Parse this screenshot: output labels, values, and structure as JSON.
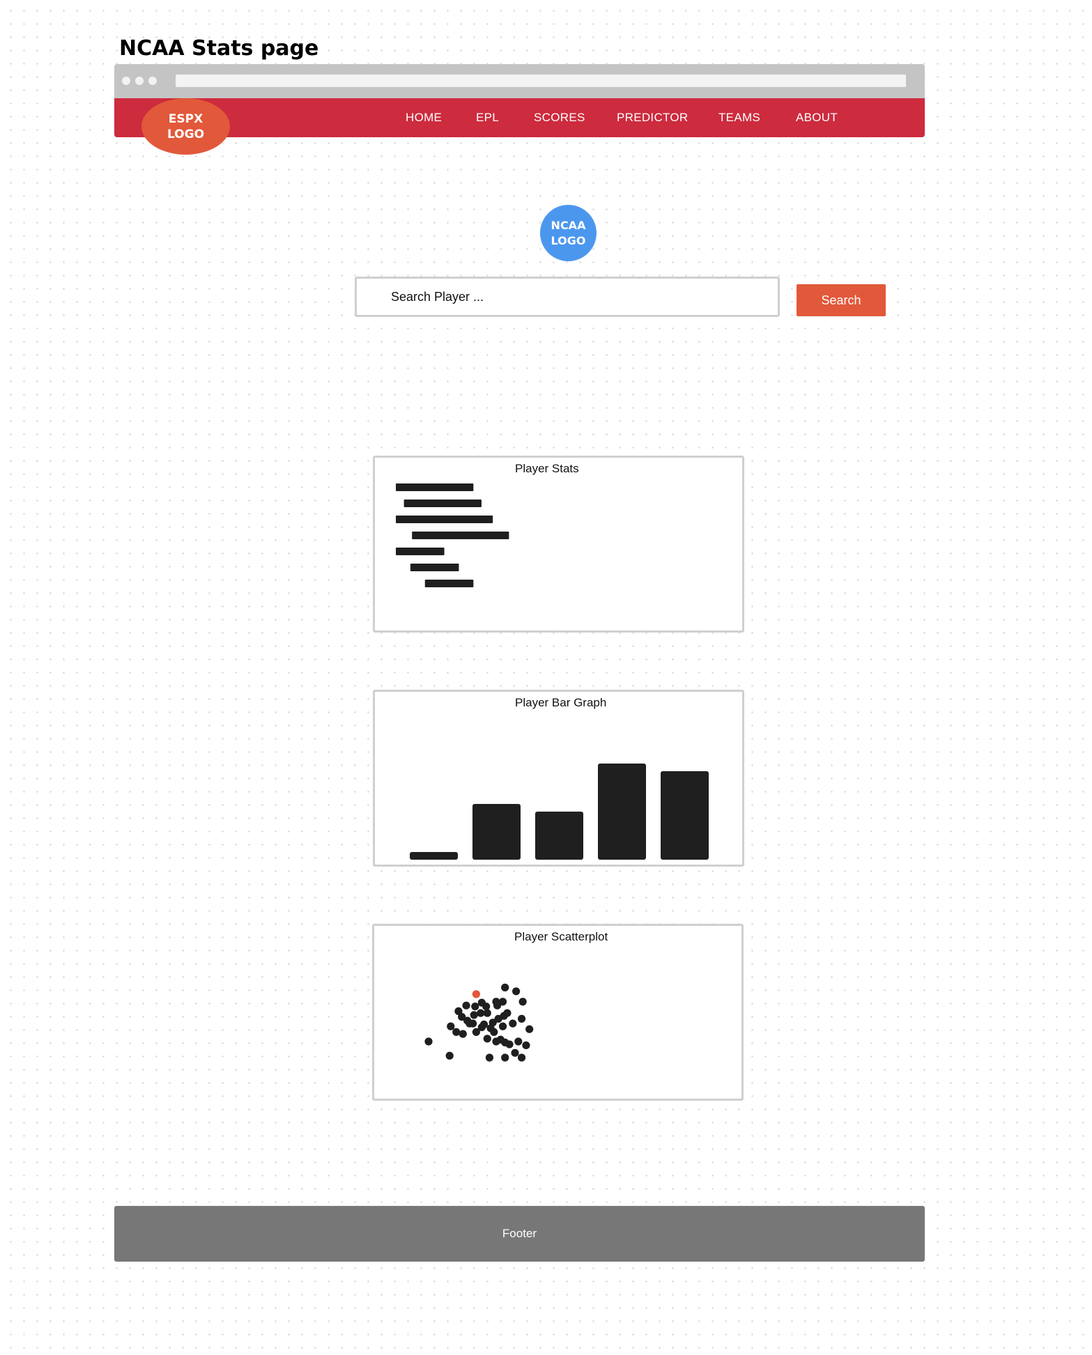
{
  "page": {
    "title": "NCAA Stats page"
  },
  "header": {
    "logo_text": "ESPX\nLOGO",
    "nav": [
      {
        "label": "HOME"
      },
      {
        "label": "EPL"
      },
      {
        "label": "SCORES"
      },
      {
        "label": "PREDICTOR"
      },
      {
        "label": "TEAMS"
      },
      {
        "label": "ABOUT"
      }
    ]
  },
  "main": {
    "ncaa_logo_text": "NCAA\nLOGO",
    "search": {
      "placeholder": "Search Player ...",
      "button_label": "Search"
    },
    "panels": {
      "stats": {
        "title": "Player Stats"
      },
      "bar": {
        "title": "Player Bar Graph"
      },
      "scatter": {
        "title": "Player Scatterplot"
      }
    }
  },
  "footer": {
    "label": "Footer"
  },
  "colors": {
    "nav_red": "#cd2b3e",
    "accent_orange": "#e2583a",
    "ncaa_blue": "#4b97ee",
    "footer_gray": "#777777",
    "ink": "#1f1f1f"
  },
  "chart_data": [
    {
      "type": "bar",
      "orientation": "horizontal",
      "note": "placeholder skeleton lines",
      "values": [
        {
          "offset": 0,
          "length": 48
        },
        {
          "offset": 5,
          "length": 48
        },
        {
          "offset": 0,
          "length": 60
        },
        {
          "offset": 10,
          "length": 60
        },
        {
          "offset": 0,
          "length": 30
        },
        {
          "offset": 9,
          "length": 30
        },
        {
          "offset": 18,
          "length": 30
        }
      ]
    },
    {
      "type": "bar",
      "values": [
        0.08,
        0.58,
        0.5,
        1.0,
        0.92
      ]
    },
    {
      "type": "scatter",
      "points": [
        {
          "x": 0.0,
          "y": 0.0
        },
        {
          "x": 0.19,
          "y": -0.15
        },
        {
          "x": 0.25,
          "y": 0.1
        },
        {
          "x": 0.2,
          "y": 0.16
        },
        {
          "x": 0.3,
          "y": 0.26
        },
        {
          "x": 0.35,
          "y": 0.22
        },
        {
          "x": 0.42,
          "y": 0.37
        },
        {
          "x": 0.43,
          "y": 0.5,
          "highlight": true
        },
        {
          "x": 0.37,
          "y": 0.19
        },
        {
          "x": 0.27,
          "y": 0.32
        },
        {
          "x": 0.31,
          "y": 0.08
        },
        {
          "x": 0.4,
          "y": 0.19
        },
        {
          "x": 0.47,
          "y": 0.3
        },
        {
          "x": 0.41,
          "y": 0.28
        },
        {
          "x": 0.43,
          "y": 0.1
        },
        {
          "x": 0.52,
          "y": 0.37
        },
        {
          "x": 0.53,
          "y": 0.3
        },
        {
          "x": 0.58,
          "y": 0.2
        },
        {
          "x": 0.56,
          "y": 0.14
        },
        {
          "x": 0.48,
          "y": 0.15
        },
        {
          "x": 0.53,
          "y": 0.03
        },
        {
          "x": 0.5,
          "y": 0.18
        },
        {
          "x": 0.59,
          "y": 0.1
        },
        {
          "x": 0.63,
          "y": 0.24
        },
        {
          "x": 0.62,
          "y": 0.38
        },
        {
          "x": 0.67,
          "y": 0.16
        },
        {
          "x": 0.68,
          "y": 0.27
        },
        {
          "x": 0.61,
          "y": 0.0
        },
        {
          "x": 0.65,
          "y": 0.02
        },
        {
          "x": 0.69,
          "y": -0.01
        },
        {
          "x": 0.73,
          "y": -0.03
        },
        {
          "x": 0.76,
          "y": 0.19
        },
        {
          "x": 0.71,
          "y": 0.3
        },
        {
          "x": 0.67,
          "y": 0.42
        },
        {
          "x": 0.79,
          "y": 0.53
        },
        {
          "x": 0.85,
          "y": 0.42
        },
        {
          "x": 0.84,
          "y": 0.24
        },
        {
          "x": 0.91,
          "y": 0.13
        },
        {
          "x": 0.69,
          "y": 0.57
        },
        {
          "x": 0.61,
          "y": 0.42
        },
        {
          "x": 0.48,
          "y": 0.41
        },
        {
          "x": 0.34,
          "y": 0.38
        },
        {
          "x": 0.69,
          "y": -0.17
        },
        {
          "x": 0.55,
          "y": -0.17
        },
        {
          "x": 0.78,
          "y": -0.12
        },
        {
          "x": 0.84,
          "y": -0.17
        },
        {
          "x": 0.88,
          "y": -0.04
        },
        {
          "x": 0.81,
          "y": 0.0
        }
      ]
    }
  ]
}
